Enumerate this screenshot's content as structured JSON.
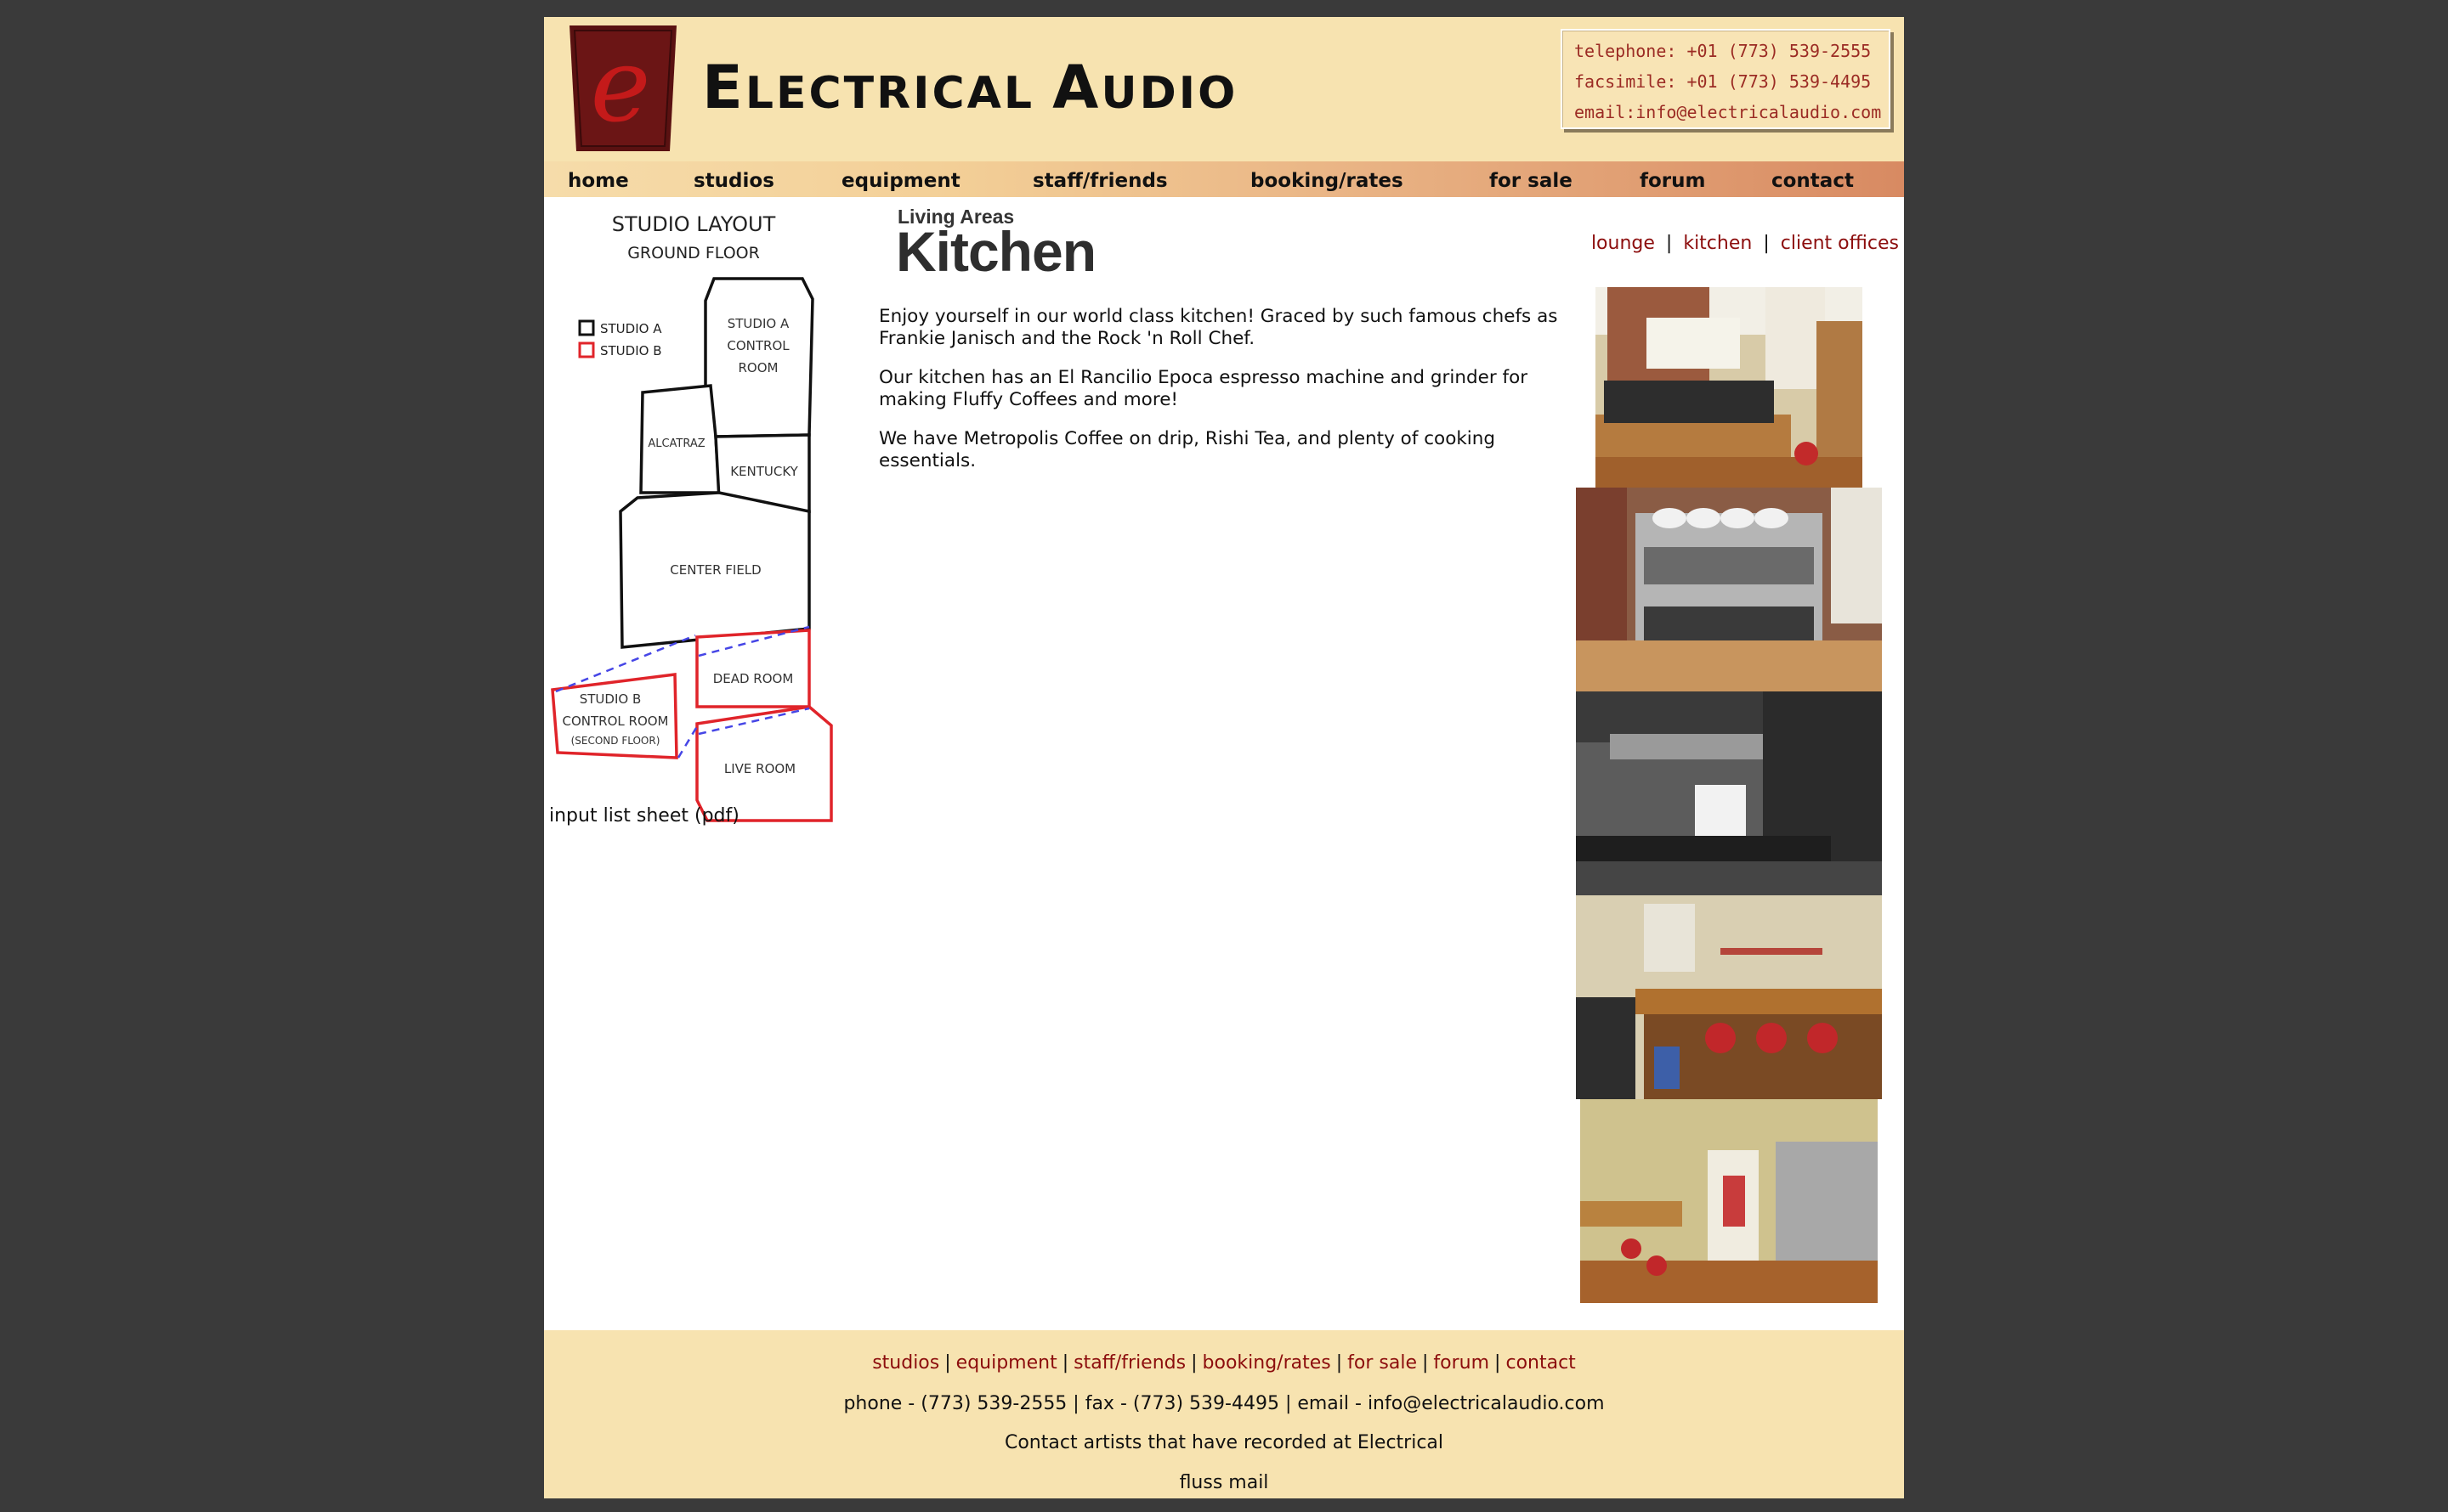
{
  "header": {
    "logo_letter": "e",
    "logo_text_first": "E",
    "logo_text_rest1": "LECTRICAL ",
    "logo_text_second": "A",
    "logo_text_rest2": "UDIO",
    "contact": {
      "telephone": "telephone:  +01 (773) 539-2555",
      "facsimile": "facsimile:  +01 (773) 539-4495",
      "email": "email:info@electricalaudio.com"
    }
  },
  "nav": {
    "items": [
      {
        "label": "home"
      },
      {
        "label": "studios"
      },
      {
        "label": "equipment"
      },
      {
        "label": "staff/friends"
      },
      {
        "label": "booking/rates"
      },
      {
        "label": "for sale"
      },
      {
        "label": "forum"
      },
      {
        "label": "contact"
      }
    ]
  },
  "layout_map": {
    "title": "STUDIO LAYOUT",
    "subtitle": "GROUND FLOOR",
    "legend_a": "STUDIO A",
    "legend_b": "STUDIO B",
    "rooms": {
      "studio_a_control_1": "STUDIO A",
      "studio_a_control_2": "CONTROL",
      "studio_a_control_3": "ROOM",
      "alcatraz": "ALCATRAZ",
      "kentucky": "KENTUCKY",
      "center_field": "CENTER FIELD",
      "dead_room": "DEAD ROOM",
      "studio_b_control_1": "STUDIO B",
      "studio_b_control_2": "CONTROL ROOM",
      "studio_b_control_3": "(SECOND FLOOR)",
      "live_room": "LIVE ROOM"
    },
    "colors": {
      "studio_a": "#111111",
      "studio_b": "#e0242a",
      "link": "#4646e6"
    }
  },
  "input_list": "input list sheet (pdf)",
  "section": {
    "subtitle": "Living Areas",
    "title": "Kitchen"
  },
  "subnav": {
    "lounge": "lounge",
    "kitchen": "kitchen",
    "client_offices": "client offices",
    "separator": "|"
  },
  "body": {
    "p1": "Enjoy yourself in our world class kitchen! Graced by such famous chefs as Frankie Janisch and the Rock 'n Roll Chef.",
    "p2": "Our kitchen has an El Rancilio Epoca espresso machine and grinder for making Fluffy Coffees and more!",
    "p3": "We have Metropolis Coffee on drip, Rishi Tea, and plenty of cooking essentials."
  },
  "footer": {
    "links": [
      "studios",
      "equipment",
      "staff/friends",
      "booking/rates",
      "for sale",
      "forum",
      "contact"
    ],
    "contact_line": "phone - (773) 539-2555 | fax - (773) 539-4495 | email - info@electricalaudio.com",
    "artists_line": "Contact artists that have recorded at Electrical",
    "fluss_line": "fluss mail"
  },
  "colors": {
    "header_bg": "#f7e3b0",
    "link_red": "#8c0d0d",
    "page_bg": "#3a3a3a"
  }
}
